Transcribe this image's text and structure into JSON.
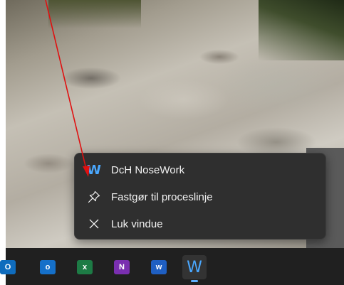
{
  "context_menu": {
    "items": [
      {
        "label": "DcH NoseWork",
        "icon": "wordpad-w-icon"
      },
      {
        "label": "Fastgør til proceslinje",
        "icon": "pin-icon"
      },
      {
        "label": "Luk vindue",
        "icon": "close-icon"
      }
    ]
  },
  "taskbar": {
    "apps": [
      {
        "name": "outlook-new-icon",
        "letter": "O"
      },
      {
        "name": "outlook-icon",
        "letter": "o"
      },
      {
        "name": "excel-icon",
        "letter": "x"
      },
      {
        "name": "onenote-icon",
        "letter": "N"
      },
      {
        "name": "word-icon",
        "letter": "w"
      },
      {
        "name": "wordpad-icon",
        "letter": "W",
        "active": true
      }
    ]
  },
  "colors": {
    "menu_bg": "#2f2f2f",
    "taskbar_bg": "#202020",
    "annotation_arrow": "#e01010",
    "app_accent": "#4aa8ff"
  }
}
